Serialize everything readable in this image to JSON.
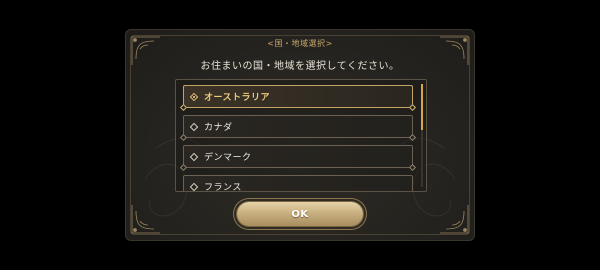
{
  "dialog": {
    "title": "<国・地域選択>",
    "prompt": "お住まいの国・地域を選択してください。",
    "options": [
      {
        "label": "オーストラリア",
        "selected": true
      },
      {
        "label": "カナダ",
        "selected": false
      },
      {
        "label": "デンマーク",
        "selected": false
      },
      {
        "label": "フランス",
        "selected": false
      }
    ],
    "ok_label": "OK"
  },
  "colors": {
    "accent_gold": "#c9a96a",
    "selected_text": "#f0cb7e",
    "panel_bg": "#25231f",
    "page_bg": "#000000"
  }
}
